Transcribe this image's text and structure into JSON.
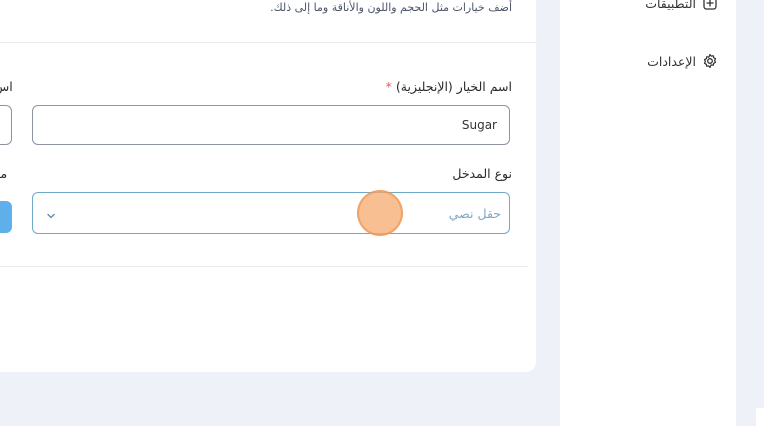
{
  "form": {
    "subtitle": "أضف خيارات مثل الحجم واللون والأناقة وما إلى ذلك.",
    "option_name_en_label": "اسم الخيار (الإنجليزية)",
    "required_mark": "*",
    "option_name_en_value": "Sugar",
    "input_type_label": "نوع المدخل",
    "input_type_value": "حقل نصي",
    "cut_label_top": "اس",
    "cut_label_bottom": "مد"
  },
  "sidebar": {
    "items": [
      {
        "label": "التطبيقات",
        "icon": "apps-icon"
      },
      {
        "label": "الإعدادات",
        "icon": "gear-icon"
      }
    ]
  },
  "colors": {
    "accent": "#5fb0ea",
    "required": "#e35d5d",
    "select_border": "#6fa9c7",
    "page_bg": "#eef1f7"
  }
}
